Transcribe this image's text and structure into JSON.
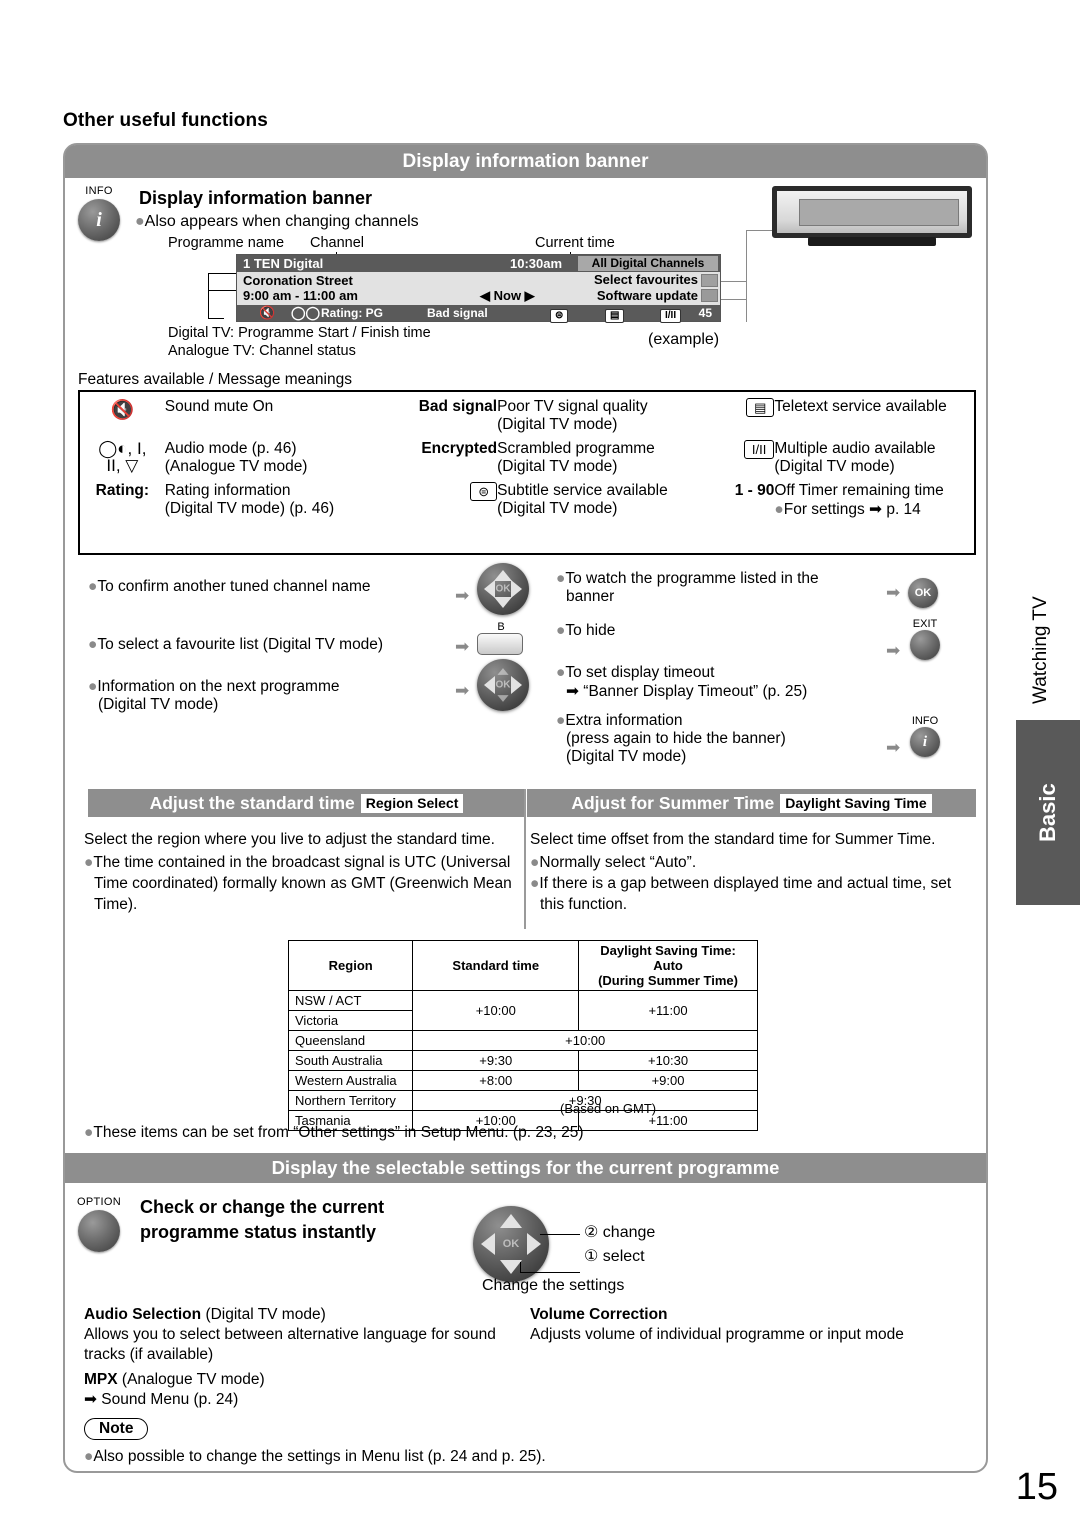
{
  "page": {
    "top_heading": "Other useful functions",
    "page_number": "15",
    "side_tabs": {
      "chapter": "Watching TV",
      "section": "Basic"
    }
  },
  "section1": {
    "bar_title": "Display information banner",
    "key_label": "INFO",
    "key_glyph": "i",
    "title": "Display information banner",
    "bullet": "Also appears when changing channels",
    "callouts": {
      "programme_name": "Programme name",
      "channel": "Channel",
      "current_time": "Current time",
      "below_line1": "Digital TV: Programme Start / Finish time",
      "below_line2": "Analogue TV: Channel status",
      "example": "(example)"
    },
    "banner": {
      "channel": "1 TEN Digital",
      "time": "10:30am",
      "all_channels": "All Digital Channels",
      "programme": "Coronation Street",
      "programme_time": "9:00 am - 11:00 am",
      "now": "◀ Now ▶",
      "select_favourites": "Select favourites",
      "software_update": "Software update",
      "rating": "Rating: PG",
      "bad_signal": "Bad signal",
      "mute_icon": "mute-icon",
      "audio_icon": "audio-mode-icon",
      "subtitle_icon": "subtitle-icon",
      "teletext_icon": "teletext-icon",
      "multi_audio_icon": "I/II",
      "off_timer": "45"
    },
    "features_caption": "Features available / Message meanings",
    "features": [
      {
        "left_symbol": "mute-icon",
        "left_text": "Sound mute On",
        "left_sub": "",
        "mid_symbol": "Bad signal",
        "mid_symbol_bold": true,
        "mid_text": "Poor TV signal quality",
        "mid_sub": "(Digital TV mode)",
        "right_symbol": "teletext-icon",
        "right_text": "Teletext service available",
        "right_sub": ""
      },
      {
        "left_symbol": "audio-mode-icons",
        "left_text": "Audio mode (p. 46)",
        "left_sub": "(Analogue TV mode)",
        "mid_symbol": "Encrypted",
        "mid_symbol_bold": true,
        "mid_text": "Scrambled programme",
        "mid_sub": "(Digital TV mode)",
        "right_symbol": "I/II",
        "right_text": "Multiple audio available",
        "right_sub": "(Digital TV mode)"
      },
      {
        "left_symbol": "Rating:",
        "left_text": "Rating information",
        "left_sub": "(Digital TV mode) (p. 46)",
        "mid_symbol": "subtitle-icon",
        "mid_symbol_bold": false,
        "mid_text": "Subtitle service available",
        "mid_sub": "(Digital TV mode)",
        "right_symbol": "1 - 90",
        "right_text": "Off Timer remaining time",
        "right_sub": "For settings ➡ p. 14"
      }
    ],
    "actions_left": [
      {
        "text": "To confirm another tuned channel name",
        "text2": "",
        "key": "dpad-full"
      },
      {
        "text": "To select a favourite list (Digital TV mode)",
        "text2": "",
        "key": "b-button",
        "key_label": "B"
      },
      {
        "text": "Information on the next programme",
        "text2": "(Digital TV mode)",
        "key": "dpad-lr"
      }
    ],
    "actions_right": [
      {
        "text": "To watch the programme listed in the",
        "text2": "banner",
        "key": "ok-button",
        "key_label": "OK"
      },
      {
        "text": "To hide",
        "text2": "",
        "key": "exit-button",
        "key_label": "EXIT"
      },
      {
        "text": "To set display timeout",
        "text2": "➡ “Banner Display Timeout” (p. 25)",
        "key": ""
      },
      {
        "text": "Extra information",
        "text2": "(press again to hide the banner)",
        "text3": "(Digital TV mode)",
        "key": "info-button",
        "key_label": "INFO",
        "key_glyph": "i"
      }
    ]
  },
  "section2": {
    "left": {
      "header": "Adjust the standard time",
      "tag": "Region Select",
      "intro": "Select the region where you live to adjust the standard time.",
      "bullets": [
        "The time contained in the broadcast signal is UTC (Universal Time coordinated) formally known as GMT (Greenwich Mean Time)."
      ]
    },
    "right": {
      "header": "Adjust for Summer Time",
      "tag": "Daylight Saving Time",
      "intro": "Select time offset from the standard time for Summer Time.",
      "bullets": [
        "Normally select “Auto”.",
        "If there is a gap between displayed time and actual time, set this function."
      ]
    },
    "table": {
      "headers": [
        "Region",
        "Standard time",
        "Daylight Saving Time: Auto (During Summer Time)"
      ],
      "header3_line1": "Daylight Saving Time: Auto",
      "header3_line2": "(During Summer Time)",
      "rows": [
        {
          "region": "NSW / ACT",
          "standard": "+10:00",
          "dst": "+11:00"
        },
        {
          "region": "Victoria",
          "standard": "+10:00",
          "dst": "+11:00"
        },
        {
          "region": "Queensland",
          "standard": "+10:00",
          "dst": "+10:00"
        },
        {
          "region": "South Australia",
          "standard": "+9:30",
          "dst": "+10:30"
        },
        {
          "region": "Western Australia",
          "standard": "+8:00",
          "dst": "+9:00"
        },
        {
          "region": "Northern Territory",
          "standard": "+9:30",
          "dst": "+9:30"
        },
        {
          "region": "Tasmania",
          "standard": "+10:00",
          "dst": "+11:00"
        }
      ],
      "footnote": "(Based on GMT)"
    },
    "closing_bullet": "These items can be set from “Other settings” in Setup Menu. (p. 23, 25)"
  },
  "section3": {
    "bar_title": "Display the selectable settings for the current programme",
    "key_label": "OPTION",
    "title_line1": "Check or change the current",
    "title_line2": "programme status instantly",
    "step2": "② change",
    "step1": "① select",
    "caption": "Change the settings",
    "items": [
      {
        "title": "Audio Selection",
        "title_note": "(Digital TV mode)",
        "body": "Allows you to select between alternative language for sound tracks (if available)"
      },
      {
        "title": "Volume Correction",
        "title_note": "",
        "body": "Adjusts volume of individual programme or input mode"
      }
    ],
    "mpx_title": "MPX",
    "mpx_note": "(Analogue TV mode)",
    "mpx_ref": "➡ Sound Menu (p. 24)",
    "note_label": "Note",
    "note_text": "Also possible to change the settings in Menu list (p. 24 and p. 25)."
  }
}
